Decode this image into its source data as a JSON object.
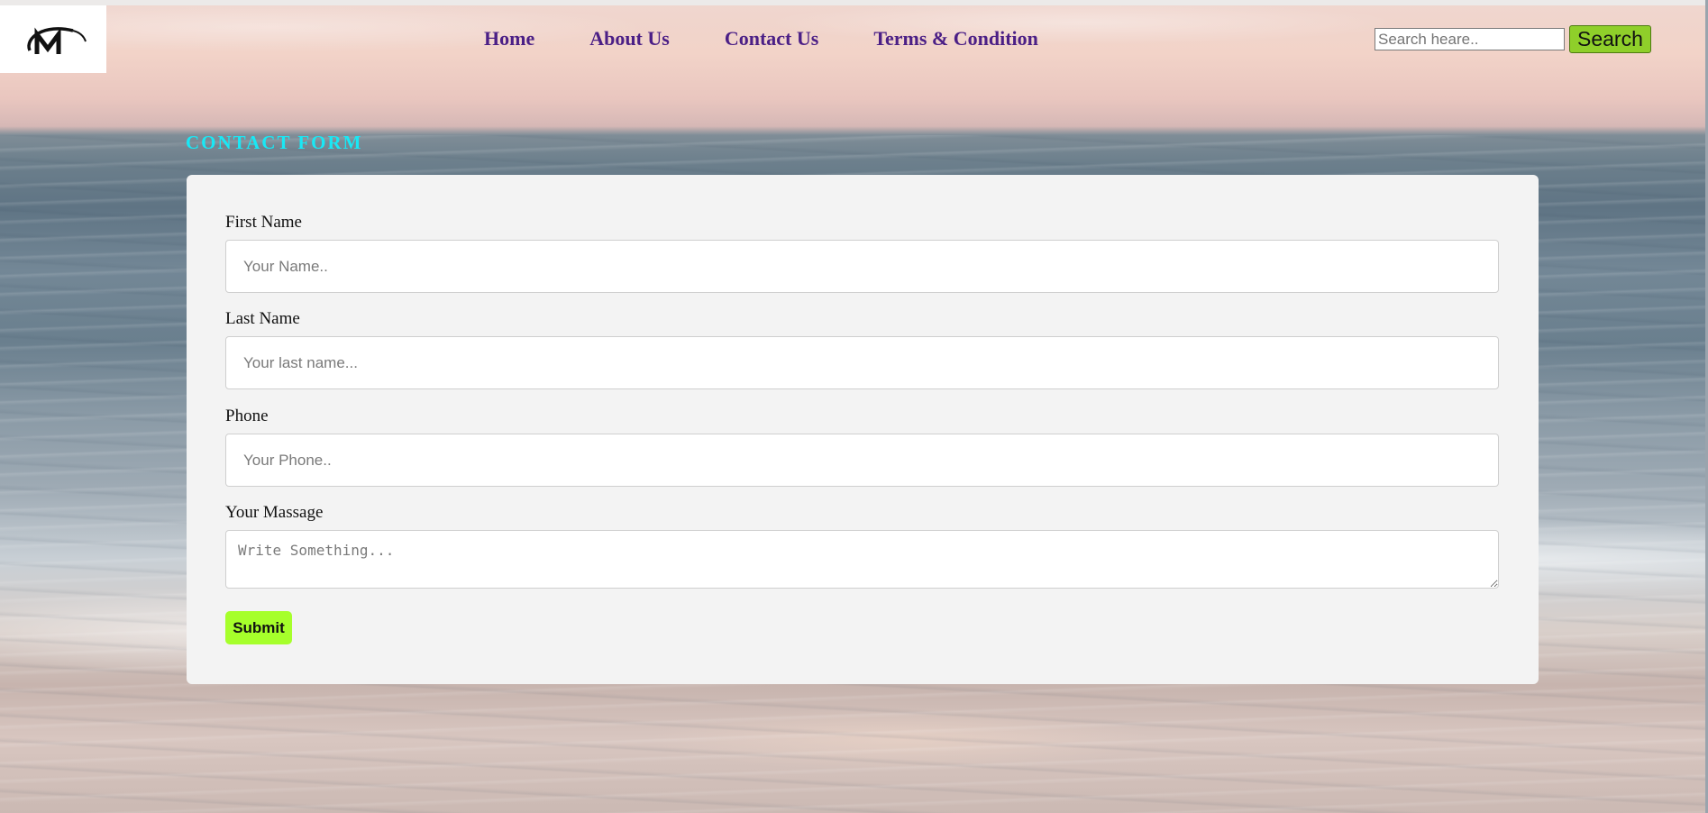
{
  "header": {
    "logo_alt": "M logo",
    "nav": [
      {
        "label": "Home"
      },
      {
        "label": "About Us"
      },
      {
        "label": "Contact Us"
      },
      {
        "label": "Terms & Condition"
      }
    ],
    "search": {
      "placeholder": "Search heare..",
      "value": "",
      "button_label": "Search"
    }
  },
  "contact_form": {
    "title": "CONTACT FORM",
    "fields": {
      "first_name": {
        "label": "First Name",
        "placeholder": "Your Name..",
        "value": ""
      },
      "last_name": {
        "label": "Last Name",
        "placeholder": "Your last name...",
        "value": ""
      },
      "phone": {
        "label": "Phone",
        "placeholder": "Your Phone..",
        "value": ""
      },
      "message": {
        "label": "Your Massage",
        "placeholder": "Write Something...",
        "value": ""
      }
    },
    "submit_label": "Submit"
  },
  "colors": {
    "nav_text": "#4b1f86",
    "title_accent": "#19e8f5",
    "search_button": "#8fcf2a",
    "submit_button": "#a6ff2b",
    "card_background": "#f3f3f3"
  }
}
